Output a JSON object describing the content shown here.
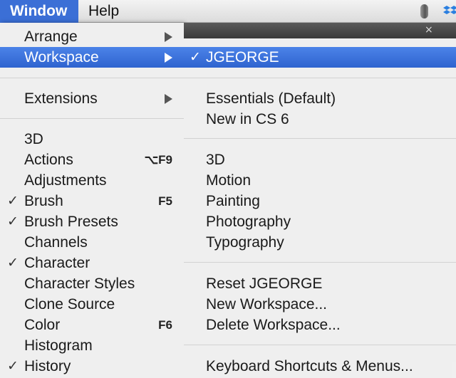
{
  "menubar": {
    "window_label": "Window",
    "help_label": "Help"
  },
  "icons": {
    "status": "status-pill-icon",
    "dropbox": "dropbox-icon",
    "close": "close-icon",
    "submenu_arrow": "chevron-right-icon",
    "checkmark": "checkmark-icon"
  },
  "colors": {
    "highlight": "#3b6fd6",
    "menu_bg": "#f6f6f6"
  },
  "window_menu": {
    "items": [
      {
        "label": "Arrange",
        "submenu": true
      },
      {
        "label": "Workspace",
        "submenu": true,
        "highlighted": true
      },
      {
        "label": "Extensions",
        "submenu": true
      },
      {
        "label": "3D"
      },
      {
        "label": "Actions",
        "shortcut": "⌥F9"
      },
      {
        "label": "Adjustments"
      },
      {
        "label": "Brush",
        "checked": true,
        "shortcut": "F5"
      },
      {
        "label": "Brush Presets",
        "checked": true
      },
      {
        "label": "Channels"
      },
      {
        "label": "Character",
        "checked": true
      },
      {
        "label": "Character Styles"
      },
      {
        "label": "Clone Source"
      },
      {
        "label": "Color",
        "shortcut": "F6"
      },
      {
        "label": "Histogram"
      },
      {
        "label": "History",
        "checked": true
      }
    ]
  },
  "workspace_submenu": {
    "close_glyph": "×",
    "items": [
      {
        "label": "JGEORGE",
        "checked": true,
        "highlighted": true
      },
      {
        "label": "Essentials (Default)"
      },
      {
        "label": "New in CS 6"
      },
      {
        "label": "3D"
      },
      {
        "label": "Motion"
      },
      {
        "label": "Painting"
      },
      {
        "label": "Photography"
      },
      {
        "label": "Typography"
      },
      {
        "label": "Reset JGEORGE"
      },
      {
        "label": "New Workspace..."
      },
      {
        "label": "Delete Workspace..."
      },
      {
        "label": "Keyboard Shortcuts & Menus..."
      }
    ]
  },
  "check_glyph": "✓"
}
